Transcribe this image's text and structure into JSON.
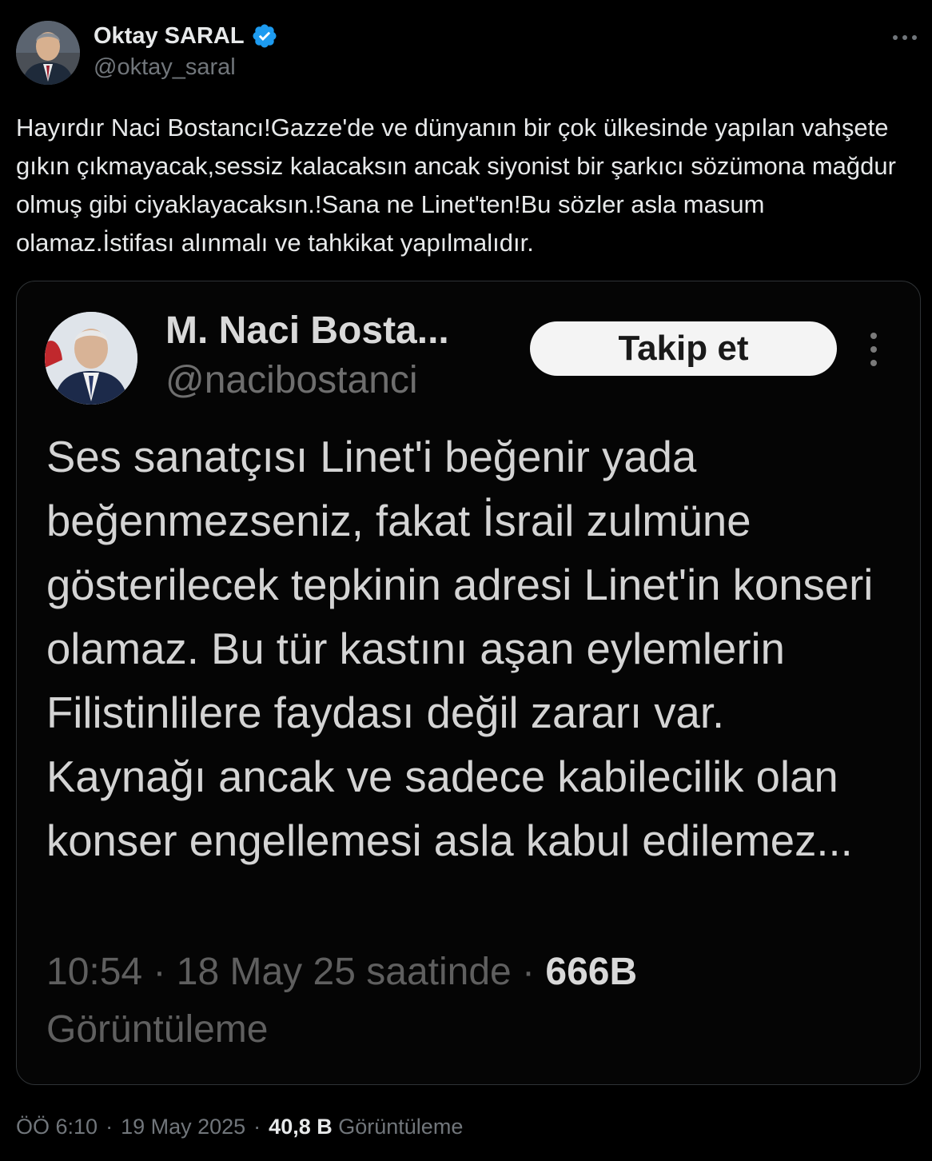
{
  "author": {
    "name": "Oktay SARAL",
    "handle": "@oktay_saral"
  },
  "tweet": {
    "text": "Hayırdır Naci Bostancı!Gazze'de ve dünyanın bir çok ülkesinde yapılan vahşete gıkın çıkmayacak,sessiz kalacaksın ancak siyonist bir şarkıcı sözümona mağdur olmuş gibi ciyaklayacaksın.!Sana ne Linet'ten!Bu sözler asla masum olamaz.İstifası alınmalı ve tahkikat yapılmalıdır."
  },
  "quoted": {
    "name": "M. Naci Bosta...",
    "handle": "@nacibostanci",
    "follow_label": "Takip et",
    "text": "Ses sanatçısı Linet'i beğenir yada beğenmezseniz, fakat İsrail zulmüne gösterilecek tepkinin adresi Linet'in konseri olamaz. Bu tür kastını aşan eylemlerin Filistinlilere faydası değil zararı var. Kaynağı ancak ve sadece kabilecilik olan konser engellemesi asla kabul edilemez...",
    "meta_time": "10:54 · 18 May 25 saatinde · ",
    "meta_views": "666B",
    "meta_views_label": "Görüntüleme"
  },
  "meta": {
    "time": "ÖÖ 6:10",
    "sep1": "·",
    "date": "19 May 2025",
    "sep2": "·",
    "views": "40,8 B",
    "views_label": "Görüntüleme"
  },
  "colors": {
    "background": "#000000",
    "text": "#e7e9ea",
    "secondary": "#71767b",
    "verified": "#1d9bf0"
  },
  "icons": [
    "verified-badge-icon",
    "more-options-icon",
    "quoted-more-icon"
  ]
}
